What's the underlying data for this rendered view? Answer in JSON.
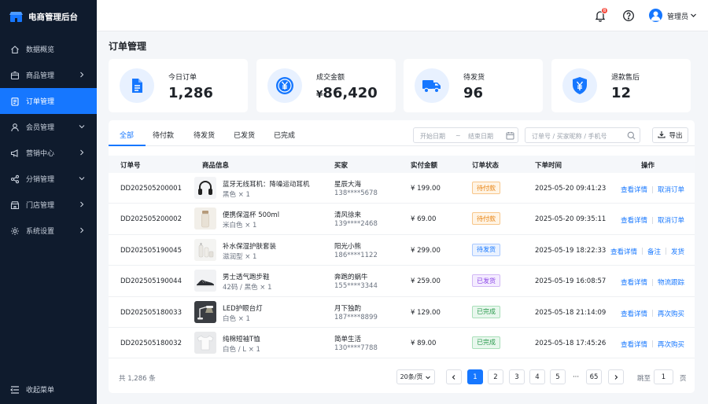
{
  "app": {
    "title": "电商管理后台"
  },
  "sidebar": {
    "items": [
      {
        "label": "数据概览",
        "icon": "home-icon",
        "chevron": false,
        "active": false
      },
      {
        "label": "商品管理",
        "icon": "box-icon",
        "chevron": "right",
        "active": false
      },
      {
        "label": "订单管理",
        "icon": "clipboard-icon",
        "chevron": false,
        "active": true
      },
      {
        "label": "会员管理",
        "icon": "user-icon",
        "chevron": "down",
        "active": false
      },
      {
        "label": "营销中心",
        "icon": "megaphone-icon",
        "chevron": "right",
        "active": false
      },
      {
        "label": "分销管理",
        "icon": "share-icon",
        "chevron": "down",
        "active": false
      },
      {
        "label": "门店管理",
        "icon": "store-icon",
        "chevron": "right",
        "active": false
      },
      {
        "label": "系统设置",
        "icon": "gear-icon",
        "chevron": "right",
        "active": false
      }
    ],
    "collapse_label": "收起菜单"
  },
  "topbar": {
    "notification_count": "8",
    "user_name": "管理员"
  },
  "page": {
    "title": "订单管理"
  },
  "stats": [
    {
      "label": "今日订单",
      "value": "1,286",
      "prefix": "",
      "icon": "document-icon"
    },
    {
      "label": "成交金额",
      "value": "86,420",
      "prefix": "¥",
      "icon": "yen-coin-icon"
    },
    {
      "label": "待发货",
      "value": "96",
      "prefix": "",
      "icon": "truck-icon"
    },
    {
      "label": "退款售后",
      "value": "12",
      "prefix": "",
      "icon": "yen-shield-icon"
    }
  ],
  "tabs": [
    "全部",
    "待付款",
    "待发货",
    "已发货",
    "已完成"
  ],
  "filters": {
    "start_placeholder": "开始日期",
    "range_sep": "~",
    "end_placeholder": "结束日期",
    "search_placeholder": "订单号 / 买家昵称 / 手机号",
    "export_label": "导出"
  },
  "table": {
    "columns": [
      "订单号",
      "商品信息",
      "买家",
      "实付金额",
      "订单状态",
      "下单时间",
      "操作"
    ],
    "rows": [
      {
        "order_no": "DD202505200001",
        "product": "蓝牙无线耳机：降噪运动耳机",
        "spec": "黑色 × 1",
        "thumb": "headphones",
        "buyer": "星辰大海",
        "phone": "138****5678",
        "amount": "¥ 199.00",
        "status": "待付款",
        "status_type": "unpaid",
        "time": "2025-05-20 09:41:23",
        "actions": [
          "查看详情",
          "取消订单"
        ]
      },
      {
        "order_no": "DD202505200002",
        "product": "便携保温杯 500ml",
        "spec": "米白色 × 1",
        "thumb": "thermos",
        "buyer": "清风徐来",
        "phone": "139****2468",
        "amount": "¥ 69.00",
        "status": "待付款",
        "status_type": "unpaid",
        "time": "2025-05-20 09:35:11",
        "actions": [
          "查看详情",
          "取消订单"
        ]
      },
      {
        "order_no": "DD202505190045",
        "product": "补水保湿护肤套装",
        "spec": "滋润型 × 1",
        "thumb": "skincare",
        "buyer": "阳光小熊",
        "phone": "186****1122",
        "amount": "¥ 299.00",
        "status": "待发货",
        "status_type": "unship",
        "time": "2025-05-19 18:22:33",
        "actions": [
          "查看详情",
          "备注",
          "发货"
        ]
      },
      {
        "order_no": "DD202505190044",
        "product": "男士透气跑步鞋",
        "spec": "42码 / 黑色 × 1",
        "thumb": "shoe",
        "buyer": "奔跑的蜗牛",
        "phone": "155****3344",
        "amount": "¥ 259.00",
        "status": "已发货",
        "status_type": "shipped",
        "time": "2025-05-19 16:08:57",
        "actions": [
          "查看详情",
          "物流跟踪"
        ]
      },
      {
        "order_no": "DD202505180033",
        "product": "LED护眼台灯",
        "spec": "白色 × 1",
        "thumb": "lamp",
        "buyer": "月下独酌",
        "phone": "187****8899",
        "amount": "¥ 129.00",
        "status": "已完成",
        "status_type": "done",
        "time": "2025-05-18 21:14:09",
        "actions": [
          "查看详情",
          "再次购买"
        ]
      },
      {
        "order_no": "DD202505180032",
        "product": "纯棉短袖T恤",
        "spec": "白色 / L × 1",
        "thumb": "tshirt",
        "buyer": "简单生活",
        "phone": "130****7788",
        "amount": "¥ 89.00",
        "status": "已完成",
        "status_type": "done",
        "time": "2025-05-18 17:45:26",
        "actions": [
          "查看详情",
          "再次购买"
        ]
      }
    ]
  },
  "pagination": {
    "total": "共 1,286 条",
    "page_size": "20条/页",
    "pages": [
      "1",
      "2",
      "3",
      "4",
      "5",
      "···",
      "65"
    ],
    "current": "1",
    "jump_label": "跳至",
    "jump_value": "1",
    "jump_suffix": "页"
  },
  "colors": {
    "primary": "#1677ff",
    "sidebar": "#0f1b2d",
    "badge": "#f5483b"
  }
}
